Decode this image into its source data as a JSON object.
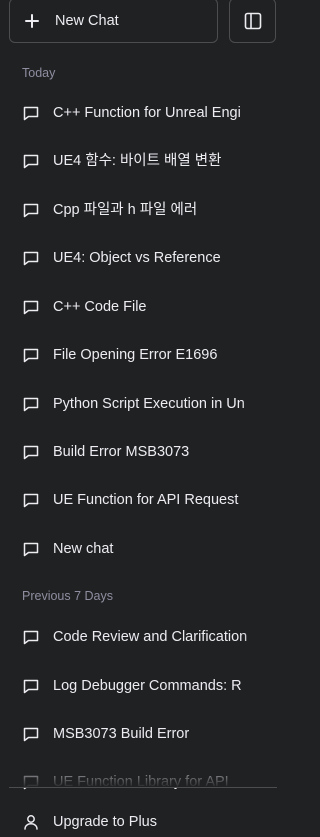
{
  "header": {
    "new_chat_label": "New Chat"
  },
  "sections": {
    "today": "Today",
    "previous_7_days": "Previous 7 Days"
  },
  "today_items": [
    "C++ Function for Unreal Engi",
    "UE4 함수: 바이트 배열 변환",
    "Cpp 파일과 h 파일 에러",
    "UE4: Object vs Reference",
    "C++ Code File",
    "File Opening Error E1696",
    "Python Script Execution in Un",
    "Build Error MSB3073",
    "UE Function for API Request",
    "New chat"
  ],
  "previous_items": [
    "Code Review and Clarification",
    "Log Debugger Commands: R",
    "MSB3073 Build Error",
    "UE Function Library for API"
  ],
  "footer": {
    "upgrade_label": "Upgrade to Plus"
  }
}
